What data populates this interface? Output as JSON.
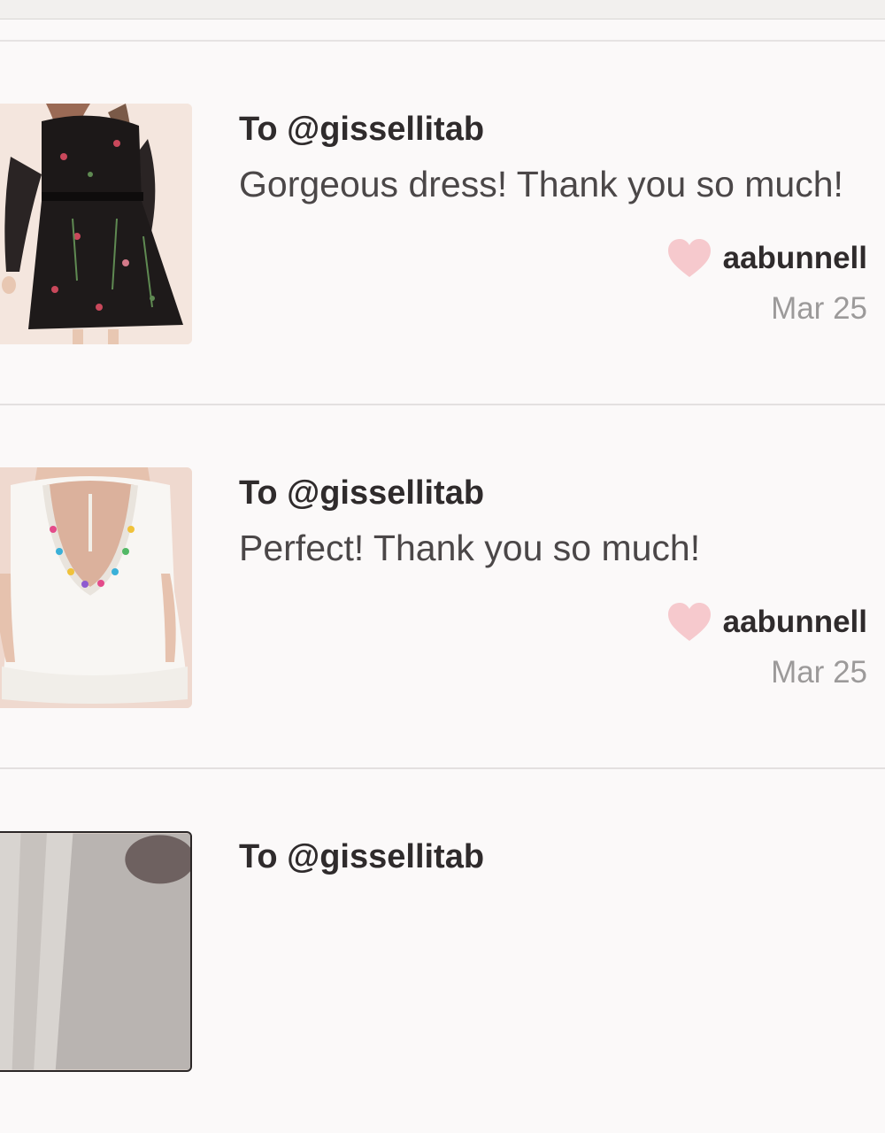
{
  "feed": {
    "items": [
      {
        "recipient": "To @gissellitab",
        "message": "Gorgeous dress! Thank you so much!",
        "author": "aabunnell",
        "date": "Mar 25",
        "image": "black floral embroidered dress"
      },
      {
        "recipient": "To @gissellitab",
        "message": "Perfect! Thank you so much!",
        "author": "aabunnell",
        "date": "Mar 25",
        "image": "white open-back crochet dress"
      },
      {
        "recipient": "To @gissellitab",
        "message": "",
        "author": "",
        "date": "",
        "image": "grey photo"
      }
    ]
  },
  "colors": {
    "heart": "#f6c9cd",
    "background": "#fbf9f9",
    "divider": "#e3e0e0"
  },
  "icons": [
    "heart-icon"
  ]
}
